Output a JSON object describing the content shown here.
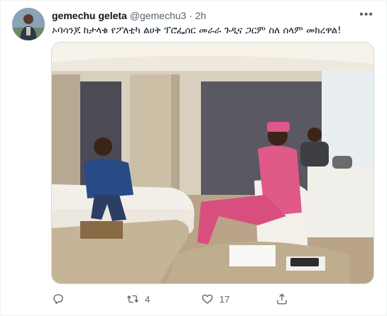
{
  "tweet": {
    "author_name": "gemechu geleta",
    "handle": "@gemechu3",
    "separator": "·",
    "time": "2h",
    "more_icon": "more-horizontal-icon",
    "text": "ኦባሳንጆ ከታላቁ የፖለቲካ ልሀቅ ፕሮፌሰር መራራ ጉዲና ጋርም ስለ ሰላም መክረዋል!"
  },
  "actions": {
    "reply": {
      "icon": "reply-icon",
      "count": ""
    },
    "retweet": {
      "icon": "retweet-icon",
      "count": "4"
    },
    "like": {
      "icon": "heart-icon",
      "count": "17"
    },
    "share": {
      "icon": "share-icon",
      "count": ""
    }
  },
  "colors": {
    "secondary_text": "#536471",
    "border": "#cfd9de",
    "background": "#ffffff"
  }
}
